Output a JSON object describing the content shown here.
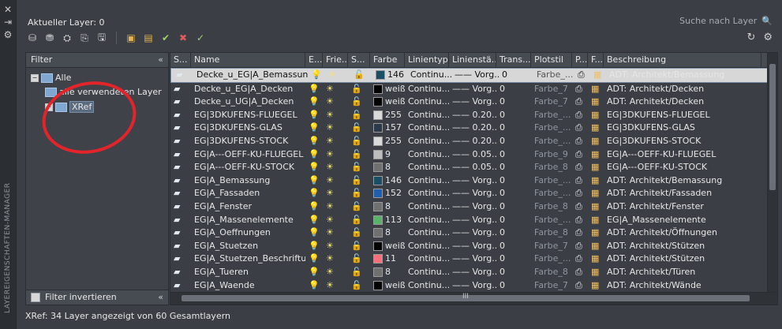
{
  "window": {
    "current_layer": "Aktueller Layer: 0",
    "search_placeholder": "Suche nach Layer",
    "vertical_title": "LAYEREIGENSCHAFTEN-MANAGER",
    "status": "XRef: 34 Layer angezeigt von 60 Gesamtlayern"
  },
  "toolbar": {
    "icons": [
      "new-layer-icon",
      "new-layer-vp-icon",
      "delete-layer-icon",
      "set-current-icon",
      "states-icon",
      "new-property-filter-icon",
      "new-group-filter-icon",
      "layer-states-icon",
      "settings-layer-icon"
    ],
    "refresh": "↻",
    "settings": "⚙"
  },
  "filter_panel": {
    "header": "Filter",
    "items": [
      {
        "label": "Alle"
      },
      {
        "label": "alle verwendeten Layer"
      },
      {
        "label": "XRef"
      }
    ],
    "invert": "Filter invertieren"
  },
  "columns": [
    "S...",
    "Name",
    "E...",
    "Frie...",
    "S...",
    "Farbe",
    "Linientyp",
    "Linienstä...",
    "Trans...",
    "Plotstil",
    "P...",
    "F...",
    "Beschreibung"
  ],
  "layers": [
    {
      "name": "Decke_u_EG|A_Bemassung",
      "color_num": "146",
      "color_hex": "#1b4f66",
      "ltype": "Continu...",
      "lweight": "—— Vorg...",
      "trans": "0",
      "plot": "Farbe_...",
      "desc": "ADT: Architekt/Bemassung"
    },
    {
      "name": "Decke_u_EG|A_Decken",
      "color_num": "weiß",
      "color_hex": "#000000",
      "ltype": "Continu...",
      "lweight": "—— Vorg...",
      "trans": "0",
      "plot": "Farbe_7",
      "desc": "ADT: Architekt/Decken"
    },
    {
      "name": "Decke_u_UG|A_Decken",
      "color_num": "weiß",
      "color_hex": "#000000",
      "ltype": "Continu...",
      "lweight": "—— Vorg...",
      "trans": "0",
      "plot": "Farbe_7",
      "desc": "ADT: Architekt/Decken"
    },
    {
      "name": "EG|3DKUFENS-FLUEGEL",
      "color_num": "255",
      "color_hex": "#d9d9d9",
      "ltype": "Continu...",
      "lweight": "—— 0.20...",
      "trans": "0",
      "plot": "Farbe_...",
      "desc": "EG|3DKUFENS-FLUEGEL"
    },
    {
      "name": "EG|3DKUFENS-GLAS",
      "color_num": "157",
      "color_hex": "#2a3a4a",
      "ltype": "Continu...",
      "lweight": "—— 0.20...",
      "trans": "0",
      "plot": "Farbe_...",
      "desc": "EG|3DKUFENS-GLAS"
    },
    {
      "name": "EG|3DKUFENS-STOCK",
      "color_num": "255",
      "color_hex": "#d9d9d9",
      "ltype": "Continu...",
      "lweight": "—— 0.20...",
      "trans": "0",
      "plot": "Farbe_...",
      "desc": "EG|3DKUFENS-STOCK"
    },
    {
      "name": "EG|A---OEFF-KU-FLUEGEL",
      "color_num": "9",
      "color_hex": "#bdbdbd",
      "ltype": "Continu...",
      "lweight": "—— 0.05...",
      "trans": "0",
      "plot": "Farbe_9",
      "desc": "EG|A---OEFF-KU-FLUEGEL"
    },
    {
      "name": "EG|A---OEFF-KU-STOCK",
      "color_num": "8",
      "color_hex": "#707070",
      "ltype": "Continu...",
      "lweight": "—— 0.05...",
      "trans": "0",
      "plot": "Farbe_8",
      "desc": "EG|A---OEFF-KU-STOCK"
    },
    {
      "name": "EG|A_Bemassung",
      "color_num": "146",
      "color_hex": "#1b4f66",
      "ltype": "Continu...",
      "lweight": "—— Vorg...",
      "trans": "0",
      "plot": "Farbe_...",
      "desc": "ADT: Architekt/Bemassung"
    },
    {
      "name": "EG|A_Fassaden",
      "color_num": "152",
      "color_hex": "#1f5fae",
      "ltype": "Continu...",
      "lweight": "—— Vorg...",
      "trans": "0",
      "plot": "Farbe_...",
      "desc": "ADT: Architekt/Fassaden"
    },
    {
      "name": "EG|A_Fenster",
      "color_num": "8",
      "color_hex": "#707070",
      "ltype": "Continu...",
      "lweight": "—— Vorg...",
      "trans": "0",
      "plot": "Farbe_8",
      "desc": "ADT: Architekt/Fenster"
    },
    {
      "name": "EG|A_Massenelemente",
      "color_num": "113",
      "color_hex": "#5bb06a",
      "ltype": "Continu...",
      "lweight": "—— Vorg...",
      "trans": "0",
      "plot": "Farbe_...",
      "desc": "EG|A_Massenelemente"
    },
    {
      "name": "EG|A_Oeffnungen",
      "color_num": "8",
      "color_hex": "#707070",
      "ltype": "Continu...",
      "lweight": "—— Vorg...",
      "trans": "0",
      "plot": "Farbe_8",
      "desc": "ADT: Architekt/Öffnungen"
    },
    {
      "name": "EG|A_Stuetzen",
      "color_num": "weiß",
      "color_hex": "#000000",
      "ltype": "Continu...",
      "lweight": "—— Vorg...",
      "trans": "0",
      "plot": "Farbe_7",
      "desc": "ADT: Architekt/Stützen"
    },
    {
      "name": "EG|A_Stuetzen_Beschriftu...",
      "color_num": "11",
      "color_hex": "#ff6f7a",
      "ltype": "Continu...",
      "lweight": "—— Vorg...",
      "trans": "0",
      "plot": "Farbe_...",
      "desc": "ADT: Architekt/Stützen"
    },
    {
      "name": "EG|A_Tueren",
      "color_num": "8",
      "color_hex": "#707070",
      "ltype": "Continu...",
      "lweight": "—— Vorg...",
      "trans": "0",
      "plot": "Farbe_8",
      "desc": "ADT: Architekt/Türen"
    },
    {
      "name": "EG|A_Waende",
      "color_num": "weiß",
      "color_hex": "#000000",
      "ltype": "Continu...",
      "lweight": "—— Vorg...",
      "trans": "0",
      "plot": "Farbe_7",
      "desc": "ADT: Architekt/Wände"
    }
  ],
  "hscroll_label": "III"
}
